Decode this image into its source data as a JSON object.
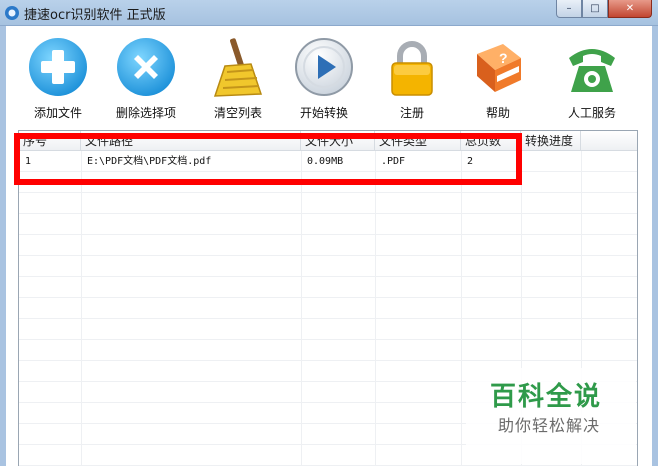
{
  "window": {
    "title": "捷速ocr识别软件 正式版",
    "minimize_glyph": "–",
    "maximize_glyph": "□",
    "close_glyph": "✕"
  },
  "toolbar": [
    {
      "label": "添加文件",
      "icon": "plus-icon"
    },
    {
      "label": "删除选择项",
      "icon": "x-icon"
    },
    {
      "label": "清空列表",
      "icon": "broom-icon"
    },
    {
      "label": "开始转换",
      "icon": "play-icon"
    },
    {
      "label": "注册",
      "icon": "lock-icon"
    },
    {
      "label": "帮助",
      "icon": "help-book-icon"
    },
    {
      "label": "人工服务",
      "icon": "phone-icon"
    }
  ],
  "table": {
    "columns": [
      "序号",
      "文件路径",
      "文件大小",
      "文件类型",
      "总页数",
      "转换进度"
    ],
    "rows": [
      [
        "1",
        "E:\\PDF文档\\PDF文档.pdf",
        "0.09MB",
        ".PDF",
        "2",
        ""
      ]
    ]
  },
  "watermark": {
    "title": "百科全说",
    "subtitle": "助你轻松解决"
  },
  "colors": {
    "accent_red": "#ff0000",
    "watermark_green": "#2f9a4a"
  }
}
